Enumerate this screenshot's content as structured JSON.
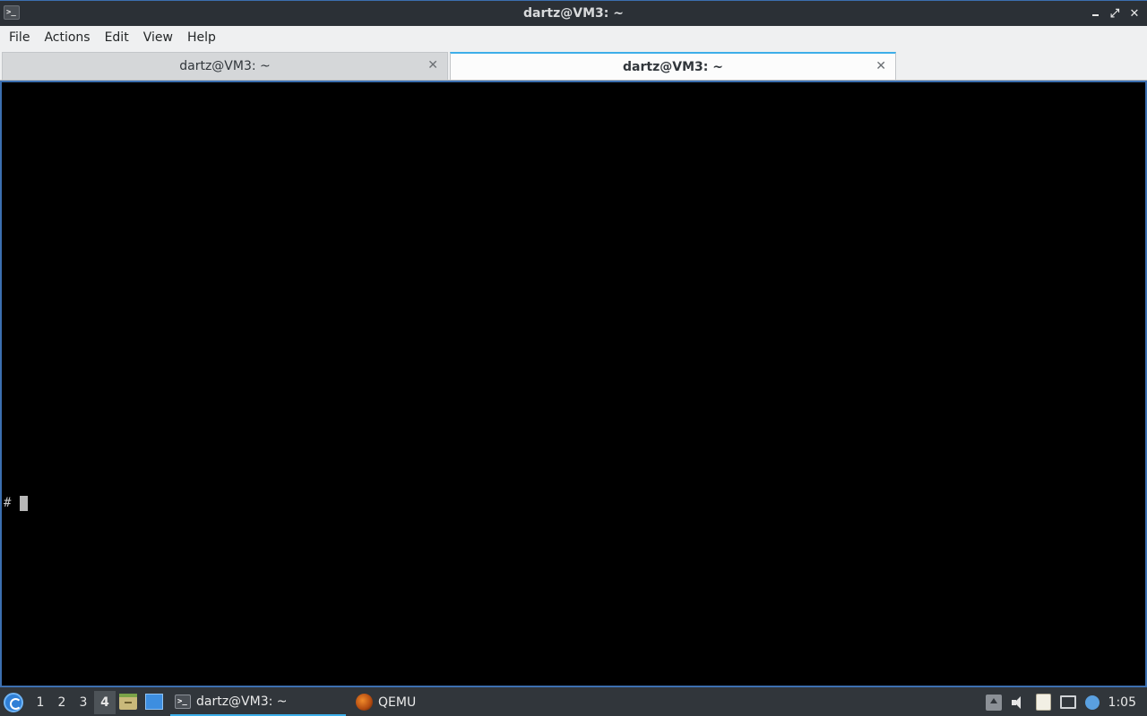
{
  "window": {
    "title": "dartz@VM3: ~",
    "app_icon_glyph": ">_"
  },
  "menu": {
    "items": [
      "File",
      "Actions",
      "Edit",
      "View",
      "Help"
    ]
  },
  "tabs": [
    {
      "label": "dartz@VM3: ~",
      "active": false
    },
    {
      "label": "dartz@VM3: ~",
      "active": true
    }
  ],
  "terminal": {
    "prompt": "#"
  },
  "taskbar": {
    "desktops": [
      "1",
      "2",
      "3",
      "4"
    ],
    "current_desktop": "4",
    "tasks": [
      {
        "label": "dartz@VM3: ~",
        "icon": "terminal-icon",
        "active": true
      },
      {
        "label": "QEMU",
        "icon": "qemu-icon",
        "active": false
      }
    ],
    "clock": "1:05"
  },
  "colors": {
    "accent": "#3daee9",
    "frame": "#3c6fb0",
    "panel": "#31363b",
    "terminal_bg": "#000000"
  }
}
